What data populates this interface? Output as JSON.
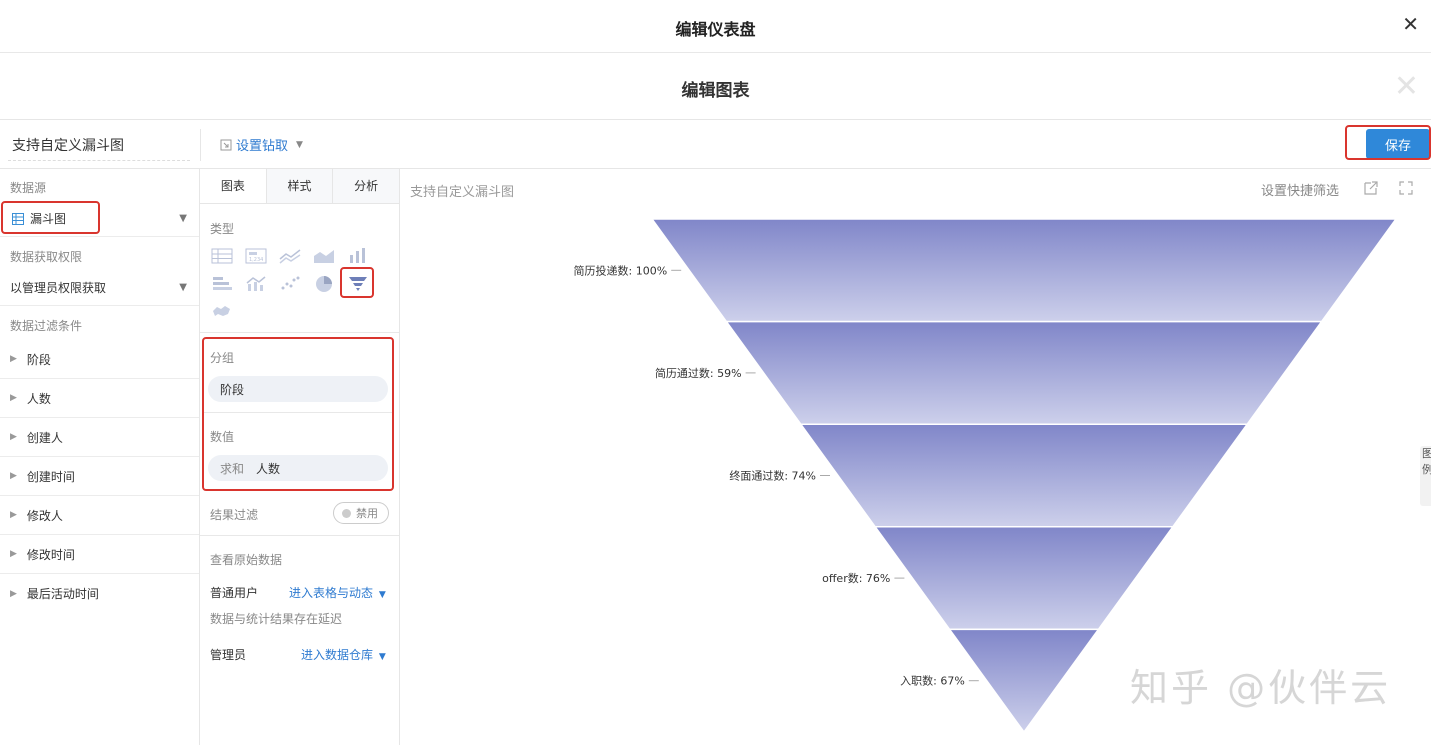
{
  "topbar": {
    "title": "编辑仪表盘",
    "close": "✕"
  },
  "subbar": {
    "title": "编辑图表",
    "close": "✕"
  },
  "toolbar": {
    "chart_name": "支持自定义漏斗图",
    "drill": "设置钻取",
    "save": "保存"
  },
  "left": {
    "datasource_label": "数据源",
    "datasource": "漏斗图",
    "permission_label": "数据获取权限",
    "permission": "以管理员权限获取",
    "filter_label": "数据过滤条件",
    "fields": [
      "阶段",
      "人数",
      "创建人",
      "创建时间",
      "修改人",
      "修改时间",
      "最后活动时间"
    ]
  },
  "middle": {
    "tabs": [
      "图表",
      "样式",
      "分析"
    ],
    "type_label": "类型",
    "group_label": "分组",
    "group_value": "阶段",
    "value_label": "数值",
    "value_agg": "求和",
    "value_field": "人数",
    "result_filter_label": "结果过滤",
    "result_filter_state": "禁用",
    "raw_data_label": "查看原始数据",
    "normal_user": "普通用户",
    "normal_user_link": "进入表格与动态",
    "delay_note": "数据与统计结果存在延迟",
    "admin": "管理员",
    "admin_link": "进入数据仓库"
  },
  "chart": {
    "title": "支持自定义漏斗图",
    "quick_filter": "设置快捷筛选",
    "legend_tab": "图例",
    "watermark": "知乎 @伙伴云"
  },
  "colors": {
    "accent": "#2f88d9",
    "highlight": "#d9352e",
    "funnel_top": "#8086c9",
    "funnel_bottom": "#cdd0eb"
  },
  "chart_data": {
    "type": "funnel",
    "title": "支持自定义漏斗图",
    "stages": [
      {
        "label": "简历投递数: 100%",
        "name": "简历投递数",
        "percent": 100
      },
      {
        "label": "简历通过数: 59%",
        "name": "简历通过数",
        "percent": 59
      },
      {
        "label": "终面通过数: 74%",
        "name": "终面通过数",
        "percent": 74
      },
      {
        "label": "offer数: 76%",
        "name": "offer数",
        "percent": 76
      },
      {
        "label": "入职数: 67%",
        "name": "入职数",
        "percent": 67
      }
    ]
  }
}
